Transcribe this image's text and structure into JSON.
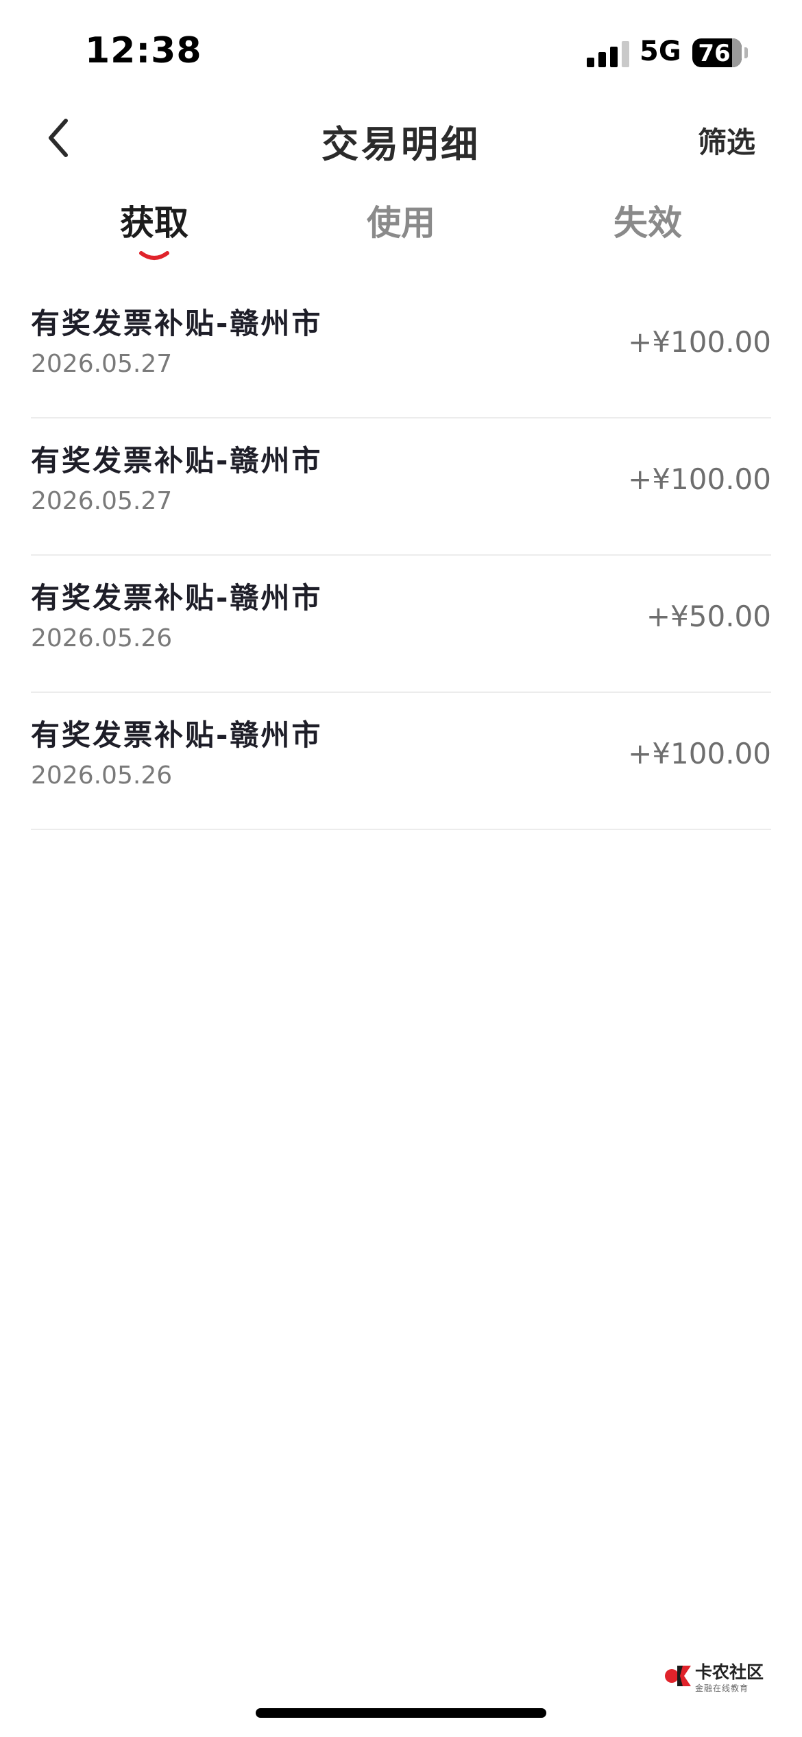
{
  "status_bar": {
    "time": "12:38",
    "network": "5G",
    "battery": "76"
  },
  "nav": {
    "title": "交易明细",
    "filter_label": "筛选",
    "back_icon": "chevron-left-icon"
  },
  "tabs": [
    {
      "label": "获取",
      "active": true
    },
    {
      "label": "使用",
      "active": false
    },
    {
      "label": "失效",
      "active": false
    }
  ],
  "accent_color": "#e0232b",
  "transactions": [
    {
      "title": "有奖发票补贴-赣州市",
      "date": "2026.05.27",
      "amount": "+¥100.00"
    },
    {
      "title": "有奖发票补贴-赣州市",
      "date": "2026.05.27",
      "amount": "+¥100.00"
    },
    {
      "title": "有奖发票补贴-赣州市",
      "date": "2026.05.26",
      "amount": "+¥50.00"
    },
    {
      "title": "有奖发票补贴-赣州市",
      "date": "2026.05.26",
      "amount": "+¥100.00"
    }
  ],
  "watermark": {
    "text": "卡农社区",
    "subtext": "金融在线教育"
  }
}
